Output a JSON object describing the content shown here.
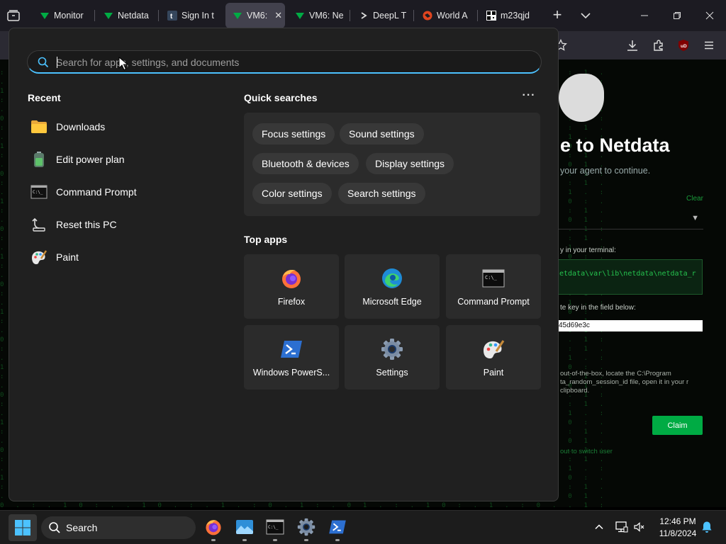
{
  "browser": {
    "tabs": [
      {
        "title": "Monitor",
        "icon": "netdata-icon"
      },
      {
        "title": "Netdata",
        "icon": "netdata-icon"
      },
      {
        "title": "Sign In t",
        "icon": "tumblr-icon"
      },
      {
        "title": "VM6:",
        "icon": "netdata-icon",
        "active": true
      },
      {
        "title": "VM6: Ne",
        "icon": "netdata-icon"
      },
      {
        "title": "DeepL T",
        "icon": "deepl-icon"
      },
      {
        "title": "World A",
        "icon": "world-atlas-icon"
      },
      {
        "title": "m23qjd",
        "icon": "qr-icon"
      }
    ],
    "toolbar": {
      "extension_badge": "uD"
    }
  },
  "netdata_page": {
    "title": "e to Netdata",
    "subtitle": "your agent to continue.",
    "clear_link": "Clear",
    "run_label": "y in your terminal:",
    "command": "etdata\\var\\lib\\netdata\\netdata_r",
    "paste_label": "te key in the field below:",
    "key_value": "45d69e3c",
    "note": "out-of-the-box, locate the C:\\Program ta_random_session_id file, open it in your r clipboard.",
    "claim_button": "Claim",
    "switch_user": "out to switch user"
  },
  "start_menu": {
    "search_placeholder": "Search for apps, settings, and documents",
    "recent": {
      "title": "Recent",
      "items": [
        {
          "label": "Downloads",
          "icon": "folder-icon"
        },
        {
          "label": "Edit power plan",
          "icon": "battery-icon"
        },
        {
          "label": "Command Prompt",
          "icon": "terminal-icon"
        },
        {
          "label": "Reset this PC",
          "icon": "reset-pc-icon"
        },
        {
          "label": "Paint",
          "icon": "paint-icon"
        }
      ]
    },
    "quick_searches": {
      "title": "Quick searches",
      "items": [
        "Focus settings",
        "Sound settings",
        "Bluetooth & devices",
        "Display settings",
        "Color settings",
        "Search settings"
      ]
    },
    "top_apps": {
      "title": "Top apps",
      "items": [
        {
          "label": "Firefox",
          "icon": "firefox-icon"
        },
        {
          "label": "Microsoft Edge",
          "icon": "edge-icon"
        },
        {
          "label": "Command Prompt",
          "icon": "terminal-icon"
        },
        {
          "label": "Windows PowerS...",
          "icon": "powershell-icon"
        },
        {
          "label": "Settings",
          "icon": "settings-gear-icon"
        },
        {
          "label": "Paint",
          "icon": "paint-icon"
        }
      ]
    }
  },
  "taskbar": {
    "search_label": "Search",
    "time": "12:46 PM",
    "date": "11/8/2024"
  },
  "colors": {
    "accent": "#4cc2ff",
    "netdata_green": "#00ab44",
    "panel": "#202020"
  }
}
